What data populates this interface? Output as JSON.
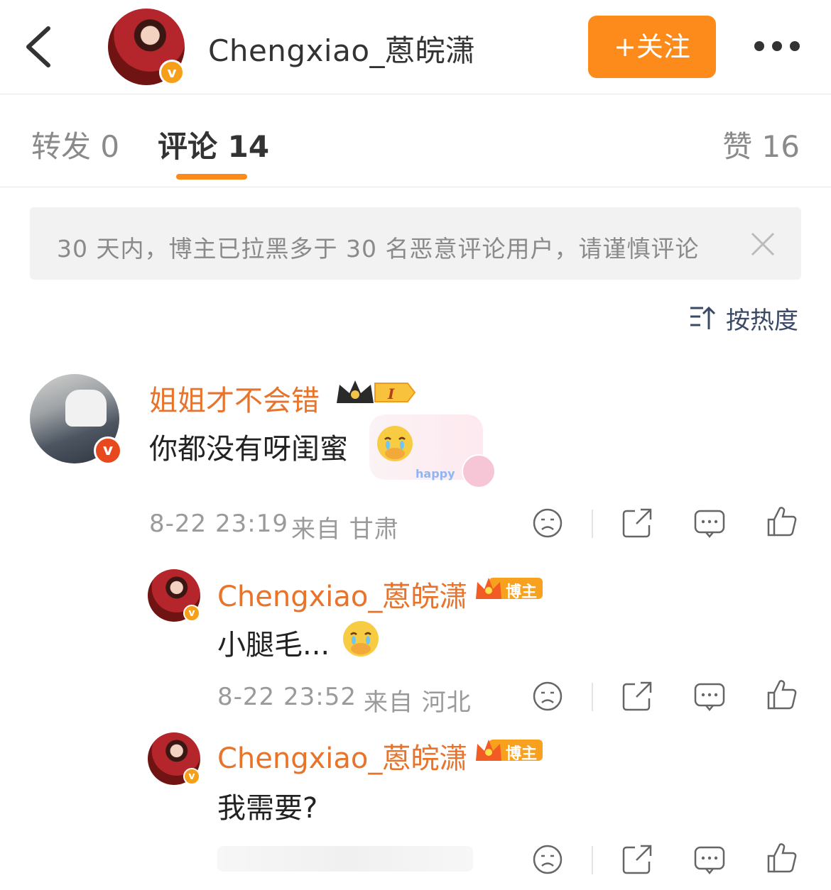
{
  "header": {
    "title": "Chengxiao_蒽皖潇",
    "follow_label": "+关注",
    "back_icon": "chevron-left-icon",
    "more_icon": "more-dots-icon"
  },
  "tabs": {
    "repost": "转发 0",
    "comments": "评论 14",
    "likes": "赞 16",
    "active": "comments"
  },
  "notice": {
    "text": "30 天内，博主已拉黑多于 30 名恶意评论用户，请谨慎评论"
  },
  "sort": {
    "label": "按热度"
  },
  "comment": {
    "username": "姐姐才不会错",
    "level_badge": "I",
    "text": "你都没有呀闺蜜",
    "decoration_tag": "happy",
    "time": "8-22 23:19",
    "location": "来自 甘肃"
  },
  "replies": [
    {
      "username": "Chengxiao_蒽皖潇",
      "badge": "博主",
      "text": "小腿毛...",
      "time": "8-22 23:52",
      "location": "来自 河北"
    },
    {
      "username": "Chengxiao_蒽皖潇",
      "badge": "博主",
      "text": "我需要?"
    }
  ],
  "colors": {
    "accent": "#fc8b1c",
    "username": "#e8732a",
    "muted": "#9a9a9a"
  }
}
